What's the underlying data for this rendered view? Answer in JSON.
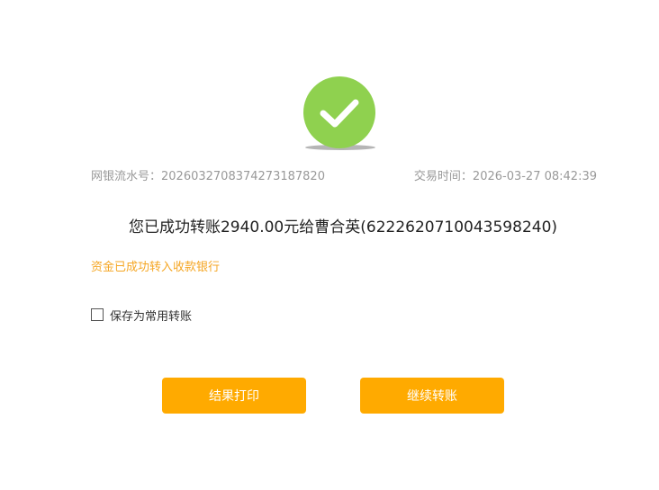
{
  "status": {
    "icon": "check-icon",
    "color": "#8fd14f"
  },
  "transaction": {
    "serial_label": "网银流水号：",
    "serial_value": "20260327083742731878​20",
    "time_label": "交易时间：",
    "time_value": "2026-03-27 08:42:39"
  },
  "message": {
    "main": "您已成功转账2940.00元给曹合英(6222620710043598240)",
    "notice": "资金已成功转入收款银行"
  },
  "save_option": {
    "label": "保存为常用转账",
    "checked": false
  },
  "buttons": {
    "print_label": "结果打印",
    "continue_label": "继续转账",
    "accent_color": "#ffaa00"
  }
}
